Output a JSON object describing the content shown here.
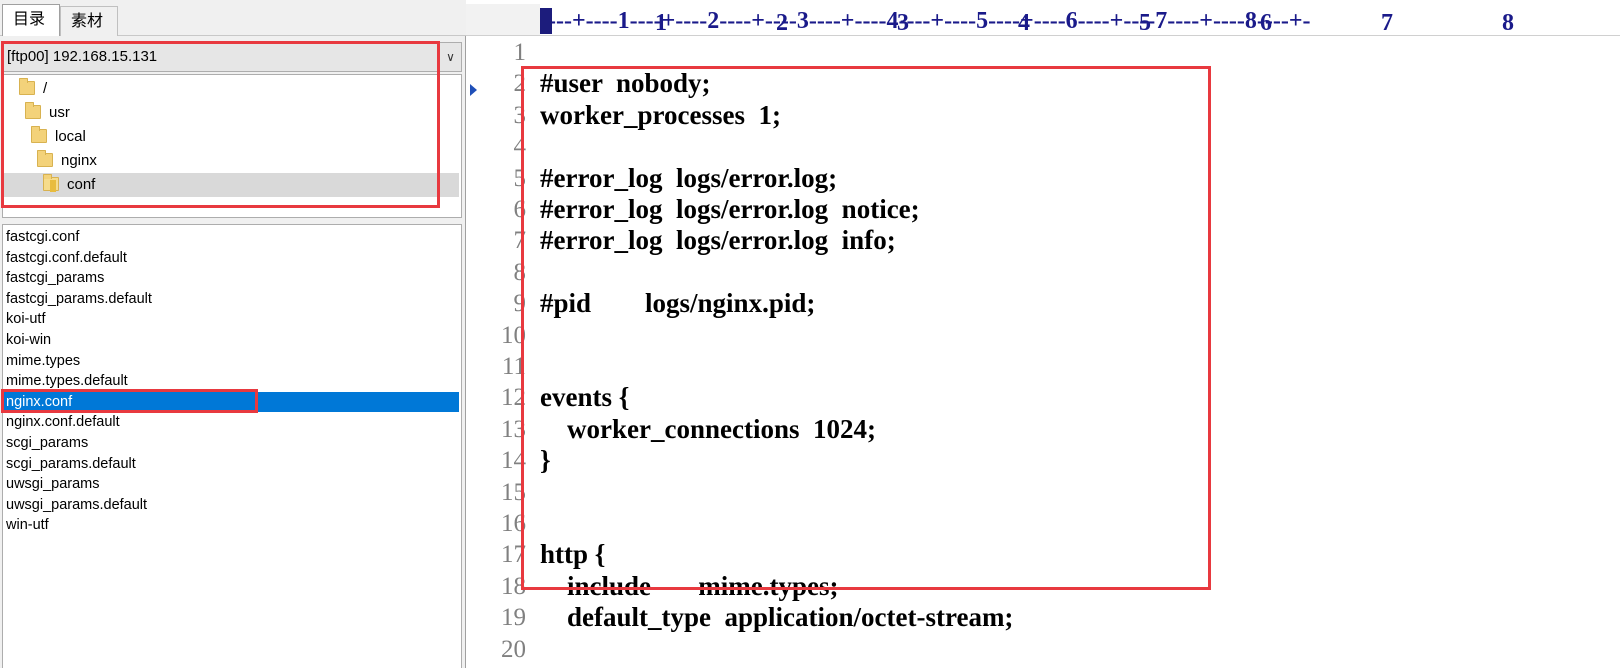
{
  "tabs": [
    {
      "label": "目录"
    },
    {
      "label": "素材"
    }
  ],
  "ftp_select": {
    "value": "[ftp00] 192.168.15.131"
  },
  "dir_tree": [
    {
      "label": "/"
    },
    {
      "label": "usr"
    },
    {
      "label": "local"
    },
    {
      "label": "nginx"
    },
    {
      "label": "conf",
      "selected": true
    }
  ],
  "files": [
    {
      "name": "fastcgi.conf"
    },
    {
      "name": "fastcgi.conf.default"
    },
    {
      "name": "fastcgi_params"
    },
    {
      "name": "fastcgi_params.default"
    },
    {
      "name": "koi-utf"
    },
    {
      "name": "koi-win"
    },
    {
      "name": "mime.types"
    },
    {
      "name": "mime.types.default"
    },
    {
      "name": "nginx.conf",
      "selected": true
    },
    {
      "name": "nginx.conf.default"
    },
    {
      "name": "scgi_params"
    },
    {
      "name": "scgi_params.default"
    },
    {
      "name": "uwsgi_params"
    },
    {
      "name": "uwsgi_params.default"
    },
    {
      "name": "win-utf"
    }
  ],
  "ruler": {
    "ticks": "----+----1----+----2----+----3----+----4----+----5----+----6----+----7----+----8----+-",
    "numbers": [
      "1",
      "2",
      "3",
      "4",
      "5",
      "6",
      "7",
      "8"
    ]
  },
  "editor": {
    "lines": [
      {
        "n": "1",
        "text": ""
      },
      {
        "n": "2",
        "text": "#user  nobody;"
      },
      {
        "n": "3",
        "text": "worker_processes  1;"
      },
      {
        "n": "4",
        "text": ""
      },
      {
        "n": "5",
        "text": "#error_log  logs/error.log;"
      },
      {
        "n": "6",
        "text": "#error_log  logs/error.log  notice;"
      },
      {
        "n": "7",
        "text": "#error_log  logs/error.log  info;"
      },
      {
        "n": "8",
        "text": ""
      },
      {
        "n": "9",
        "text": "#pid        logs/nginx.pid;"
      },
      {
        "n": "10",
        "text": ""
      },
      {
        "n": "11",
        "text": ""
      },
      {
        "n": "12",
        "text": "events {"
      },
      {
        "n": "13",
        "text": "    worker_connections  1024;"
      },
      {
        "n": "14",
        "text": "}"
      },
      {
        "n": "15",
        "text": ""
      },
      {
        "n": "16",
        "text": ""
      },
      {
        "n": "17",
        "text": "http {"
      },
      {
        "n": "18",
        "text": "    include       mime.types;"
      },
      {
        "n": "19",
        "text": "    default_type  application/octet-stream;"
      },
      {
        "n": "20",
        "text": ""
      }
    ]
  },
  "colors": {
    "highlight": "#e8393f",
    "selection": "#0078d7",
    "ruler": "#1a1a8a"
  }
}
